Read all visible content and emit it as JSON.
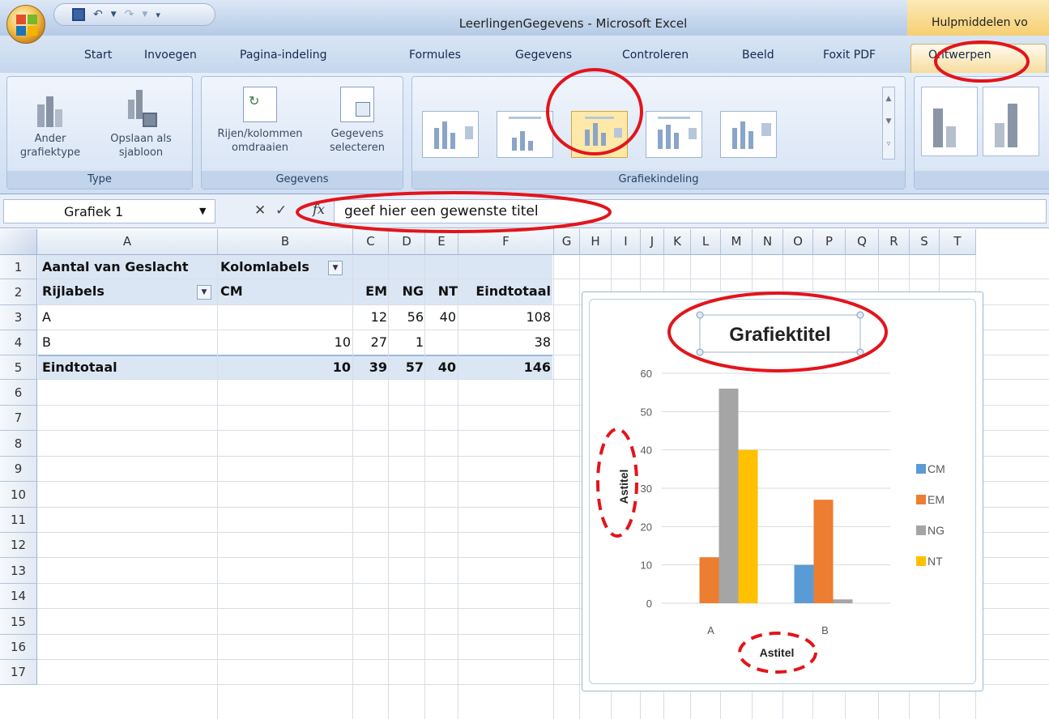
{
  "window": {
    "title": "LeerlingenGegevens - Microsoft Excel",
    "tools_group": "Hulpmiddelen vo"
  },
  "tabs": [
    "Start",
    "Invoegen",
    "Pagina-indeling",
    "Formules",
    "Gegevens",
    "Controleren",
    "Beeld",
    "Foxit PDF",
    "Ontwerpen"
  ],
  "ribbon": {
    "type_group": {
      "label": "Type",
      "change_type": "Ander\ngrafiektype",
      "save_template": "Opslaan als\nsjabloon"
    },
    "data_group": {
      "label": "Gegevens",
      "switch_row_col": "Rijen/kolommen\nomdraaien",
      "select_data": "Gegevens\nselecteren"
    },
    "layouts_group": {
      "label": "Grafiekindeling"
    }
  },
  "formula_bar": {
    "name_box": "Grafiek 1",
    "formula": "geef hier een gewenste titel"
  },
  "columns": [
    "A",
    "B",
    "C",
    "D",
    "E",
    "F",
    "G",
    "H",
    "I",
    "J",
    "K",
    "L",
    "M",
    "N",
    "O",
    "P",
    "Q",
    "R",
    "S",
    "T"
  ],
  "rows": [
    "1",
    "2",
    "3",
    "4",
    "5",
    "6",
    "7",
    "8",
    "9",
    "10",
    "11",
    "12",
    "13",
    "14",
    "15",
    "16",
    "17"
  ],
  "pivot": {
    "values_label": "Aantal van Geslacht",
    "col_labels": "Kolomlabels",
    "row_labels": "Rijlabels",
    "headers": [
      "CM",
      "EM",
      "NG",
      "NT",
      "Eindtotaal"
    ],
    "body": [
      {
        "label": "A",
        "cm": "",
        "em": "12",
        "ng": "56",
        "nt": "40",
        "total": "108"
      },
      {
        "label": "B",
        "cm": "10",
        "em": "27",
        "ng": "1",
        "nt": "",
        "total": "38"
      }
    ],
    "total": {
      "label": "Eindtotaal",
      "cm": "10",
      "em": "39",
      "ng": "57",
      "nt": "40",
      "total": "146"
    }
  },
  "chart_data": {
    "type": "bar",
    "title": "Grafiektitel",
    "xlabel": "Astitel",
    "ylabel": "Astitel",
    "categories": [
      "A",
      "B"
    ],
    "series": [
      {
        "name": "CM",
        "values": [
          0,
          10
        ],
        "color": "#5b9bd5"
      },
      {
        "name": "EM",
        "values": [
          12,
          27
        ],
        "color": "#ed7d31"
      },
      {
        "name": "NG",
        "values": [
          56,
          1
        ],
        "color": "#a5a5a5"
      },
      {
        "name": "NT",
        "values": [
          40,
          0
        ],
        "color": "#ffc000"
      }
    ],
    "ylim": [
      0,
      60
    ],
    "yticks": [
      "0",
      "10",
      "20",
      "30",
      "40",
      "50",
      "60"
    ],
    "grid": true,
    "legend": "right"
  }
}
